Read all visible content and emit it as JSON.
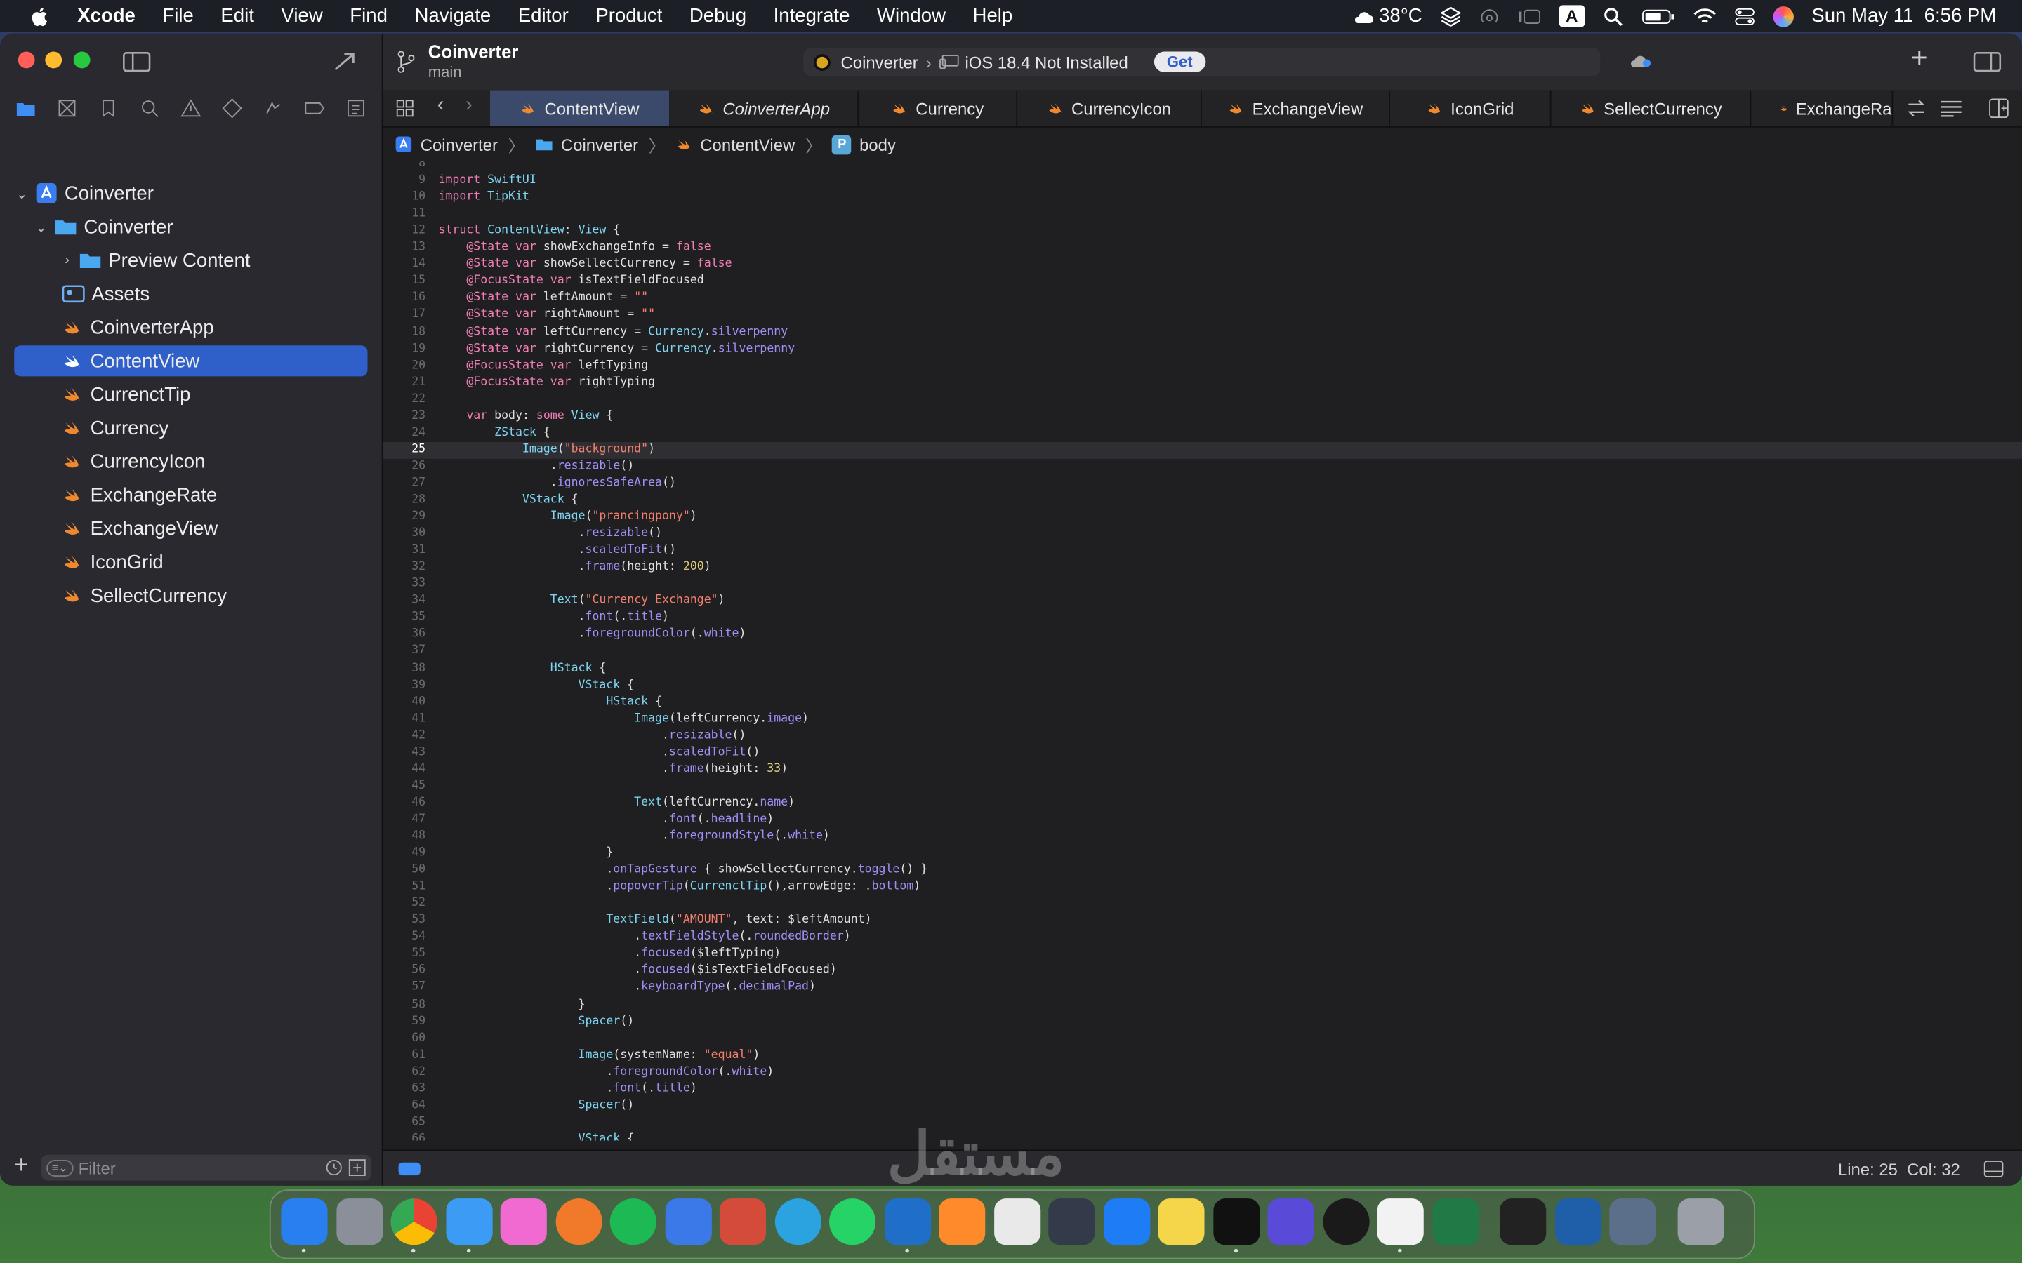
{
  "menubar": {
    "items": [
      "Xcode",
      "File",
      "Edit",
      "View",
      "Find",
      "Navigate",
      "Editor",
      "Product",
      "Debug",
      "Integrate",
      "Window",
      "Help"
    ],
    "weather": "38°C",
    "keyboard": "A",
    "datetime": "Sun May 11  6:56 PM"
  },
  "toolbar": {
    "project": "Coinverter",
    "branch": "main",
    "scheme": "Coinverter",
    "destination": "iOS 18.4 Not Installed",
    "get_label": "Get"
  },
  "sidebar": {
    "filter_placeholder": "Filter",
    "items": [
      {
        "label": "Coinverter",
        "kind": "project"
      },
      {
        "label": "Coinverter",
        "kind": "folder"
      },
      {
        "label": "Preview Content",
        "kind": "folder"
      },
      {
        "label": "Assets",
        "kind": "assets"
      },
      {
        "label": "CoinverterApp",
        "kind": "swift"
      },
      {
        "label": "ContentView",
        "kind": "swift",
        "selected": true
      },
      {
        "label": "CurrenctTip",
        "kind": "swift"
      },
      {
        "label": "Currency",
        "kind": "swift"
      },
      {
        "label": "CurrencyIcon",
        "kind": "swift"
      },
      {
        "label": "ExchangeRate",
        "kind": "swift"
      },
      {
        "label": "ExchangeView",
        "kind": "swift"
      },
      {
        "label": "IconGrid",
        "kind": "swift"
      },
      {
        "label": "SellectCurrency",
        "kind": "swift"
      }
    ]
  },
  "tabs": [
    "ContentView",
    "CoinverterApp",
    "Currency",
    "CurrencyIcon",
    "ExchangeView",
    "IconGrid",
    "SellectCurrency",
    "ExchangeRa"
  ],
  "breadcrumb": [
    "Coinverter",
    "Coinverter",
    "ContentView",
    "body"
  ],
  "breadcrumb_badge": "P",
  "code": {
    "first_line": 8,
    "current_line": 25,
    "lines": [
      "",
      "import SwiftUI",
      "import TipKit",
      "",
      "struct ContentView: View {",
      "    @State var showExchangeInfo = false",
      "    @State var showSellectCurrency = false",
      "    @FocusState var isTextFieldFocused",
      "    @State var leftAmount = \"\"",
      "    @State var rightAmount = \"\"",
      "    @State var leftCurrency = Currency.silverpenny",
      "    @State var rightCurrency = Currency.silverpenny",
      "    @FocusState var leftTyping",
      "    @FocusState var rightTyping",
      "",
      "    var body: some View {",
      "        ZStack {",
      "            Image(\"background\")",
      "                .resizable()",
      "                .ignoresSafeArea()",
      "            VStack {",
      "                Image(\"prancingpony\")",
      "                    .resizable()",
      "                    .scaledToFit()",
      "                    .frame(height: 200)",
      "",
      "                Text(\"Currency Exchange\")",
      "                    .font(.title)",
      "                    .foregroundColor(.white)",
      "",
      "                HStack {",
      "                    VStack {",
      "                        HStack {",
      "                            Image(leftCurrency.image)",
      "                                .resizable()",
      "                                .scaledToFit()",
      "                                .frame(height: 33)",
      "",
      "                            Text(leftCurrency.name)",
      "                                .font(.headline)",
      "                                .foregroundStyle(.white)",
      "                        }",
      "                        .onTapGesture { showSellectCurrency.toggle() }",
      "                        .popoverTip(CurrenctTip(),arrowEdge: .bottom)",
      "",
      "                        TextField(\"AMOUNT\", text: $leftAmount)",
      "                            .textFieldStyle(.roundedBorder)",
      "                            .focused($leftTyping)",
      "                            .focused($isTextFieldFocused)",
      "                            .keyboardType(.decimalPad)",
      "                    }",
      "                    Spacer()",
      "",
      "                    Image(systemName: \"equal\")",
      "                        .foregroundColor(.white)",
      "                        .font(.title)",
      "                    Spacer()",
      "",
      "                    VStack {"
    ]
  },
  "status": {
    "position": "Line: 25  Col: 32"
  },
  "dock": {
    "apps": [
      "finder-icon",
      "launchpad-icon",
      "chrome-icon",
      "safari-icon",
      "photo-icon",
      "firefox-icon",
      "spotify-icon",
      "xcode-icon",
      "notes-icon",
      "telegram-icon",
      "whatsapp-icon",
      "vscode-icon",
      "sublime-icon",
      "chatgpt-icon",
      "shortcut-icon",
      "appstore-icon",
      "stickies-icon",
      "terminal-icon",
      "d-app-icon",
      "ring-app-icon",
      "textedit-icon",
      "excel-icon",
      "box-app-icon",
      "quicktime-icon",
      "preview-icon",
      "trash-icon"
    ]
  },
  "colors": {
    "accent": "#2f5fc9",
    "swift": "#f0882e",
    "folder": "#4aa8f0"
  }
}
